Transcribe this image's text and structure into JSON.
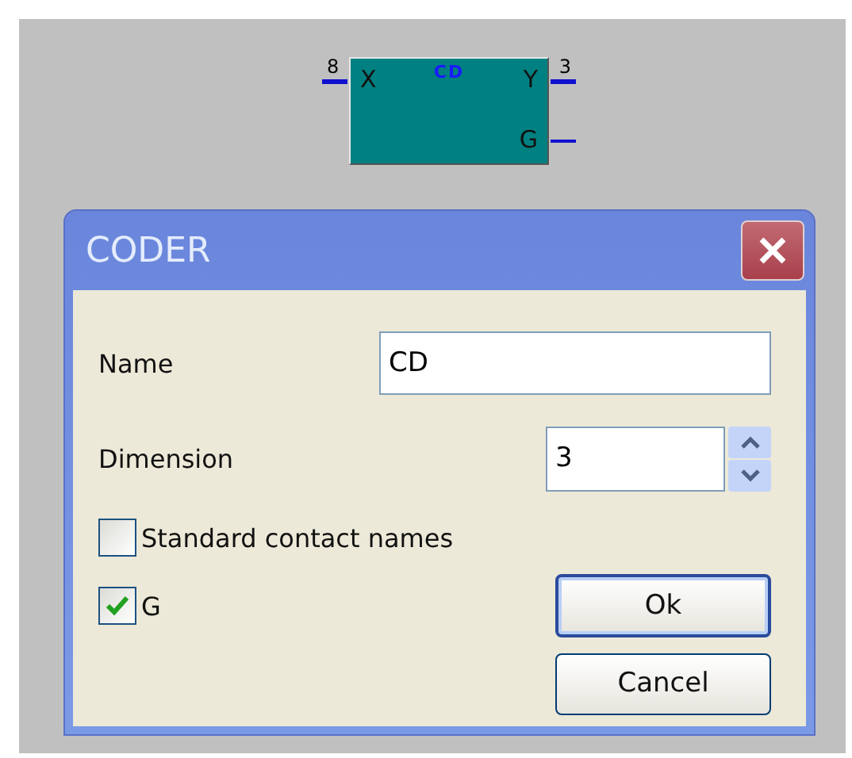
{
  "block": {
    "title": "CD",
    "inputs": [
      {
        "label": "X",
        "bus": "8"
      }
    ],
    "outputs": [
      {
        "label": "Y",
        "bus": "3"
      },
      {
        "label": "G"
      }
    ]
  },
  "dialog": {
    "title": "CODER",
    "fields": [
      {
        "kind": "text",
        "label": "Name",
        "value": "CD"
      },
      {
        "kind": "spin",
        "label": "Dimension",
        "value": "3"
      }
    ],
    "checkboxes": [
      {
        "label": "Standard contact names",
        "checked": false
      },
      {
        "label": "G",
        "checked": true
      }
    ],
    "buttons": [
      {
        "label": "Ok",
        "default": true
      },
      {
        "label": "Cancel",
        "default": false
      }
    ]
  }
}
